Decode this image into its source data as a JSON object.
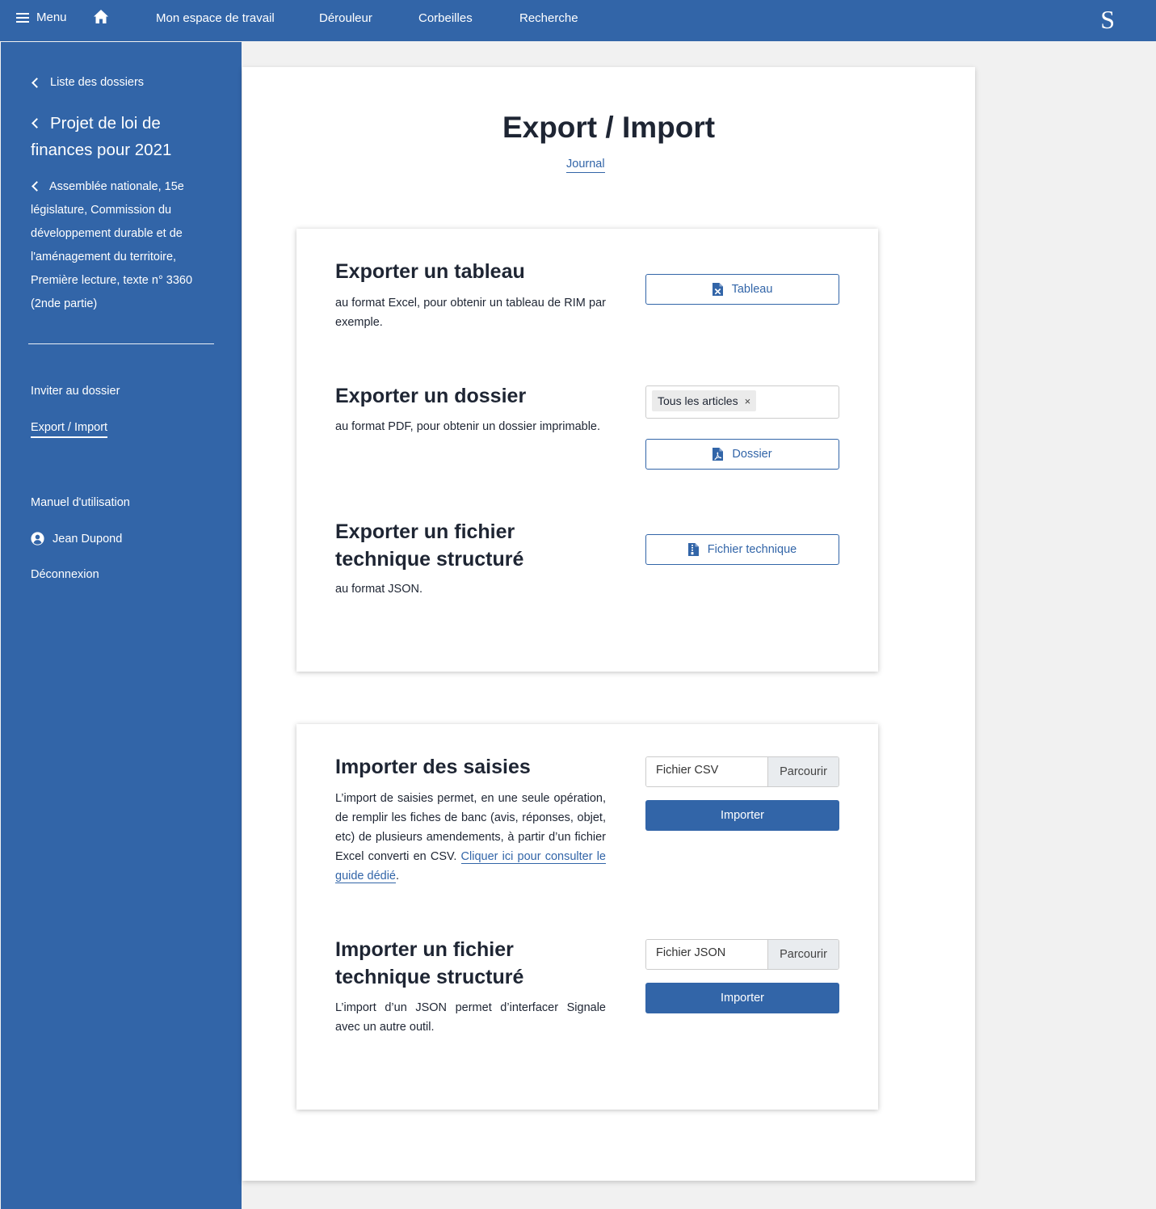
{
  "topbar": {
    "menu_label": "Menu",
    "nav": [
      "Mon espace de travail",
      "Dérouleur",
      "Corbeilles",
      "Recherche"
    ],
    "logo": "S"
  },
  "sidebar": {
    "back_list": "Liste des dossiers",
    "dossier_title": "Projet de loi de finances pour 2021",
    "context": "Assemblée nationale, 15e législature, Commission du développement durable et de l'aménagement du territoire, Première lecture, texte n° 3360 (2nde partie)",
    "links": {
      "invite": "Inviter au dossier",
      "export_import": "Export / Import",
      "manual": "Manuel d'utilisation",
      "user": "Jean Dupond",
      "logout": "Déconnexion"
    }
  },
  "main": {
    "title": "Export / Import",
    "journal": "Journal"
  },
  "export": {
    "table": {
      "title": "Exporter un tableau",
      "text": "au format Excel, pour obtenir un tableau de RIM par exemple.",
      "button": "Tableau"
    },
    "dossier": {
      "title": "Exporter un dossier",
      "text": "au format PDF, pour obtenir un dossier imprimable.",
      "chip": "Tous les articles",
      "chip_remove": "×",
      "button": "Dossier"
    },
    "tech": {
      "title": "Exporter un fichier technique structuré",
      "text": "au format JSON.",
      "button": "Fichier technique"
    }
  },
  "import": {
    "saisies": {
      "title": "Importer des saisies",
      "text": "L’import de saisies permet, en une seule opération, de remplir les fiches de banc (avis, réponses, objet, etc) de plusieurs amendements, à partir d’un fichier Excel converti en CSV.",
      "link": "Cliquer ici pour consulter le guide dédié",
      "link_suffix": ".",
      "file_placeholder": "Fichier CSV",
      "browse": "Parcourir",
      "button": "Importer"
    },
    "tech": {
      "title": "Importer un fichier technique structuré",
      "text": "L’import d’un JSON permet d’interfacer Signale avec un autre outil.",
      "file_placeholder": "Fichier JSON",
      "browse": "Parcourir",
      "button": "Importer"
    }
  },
  "colors": {
    "brand": "#3265a8",
    "text": "#1e2533",
    "background": "#f1f1f1"
  },
  "icons": [
    "hamburger-icon",
    "home-icon",
    "chevron-left-icon",
    "user-circle-icon",
    "file-excel-icon",
    "file-pdf-icon",
    "file-code-icon"
  ]
}
